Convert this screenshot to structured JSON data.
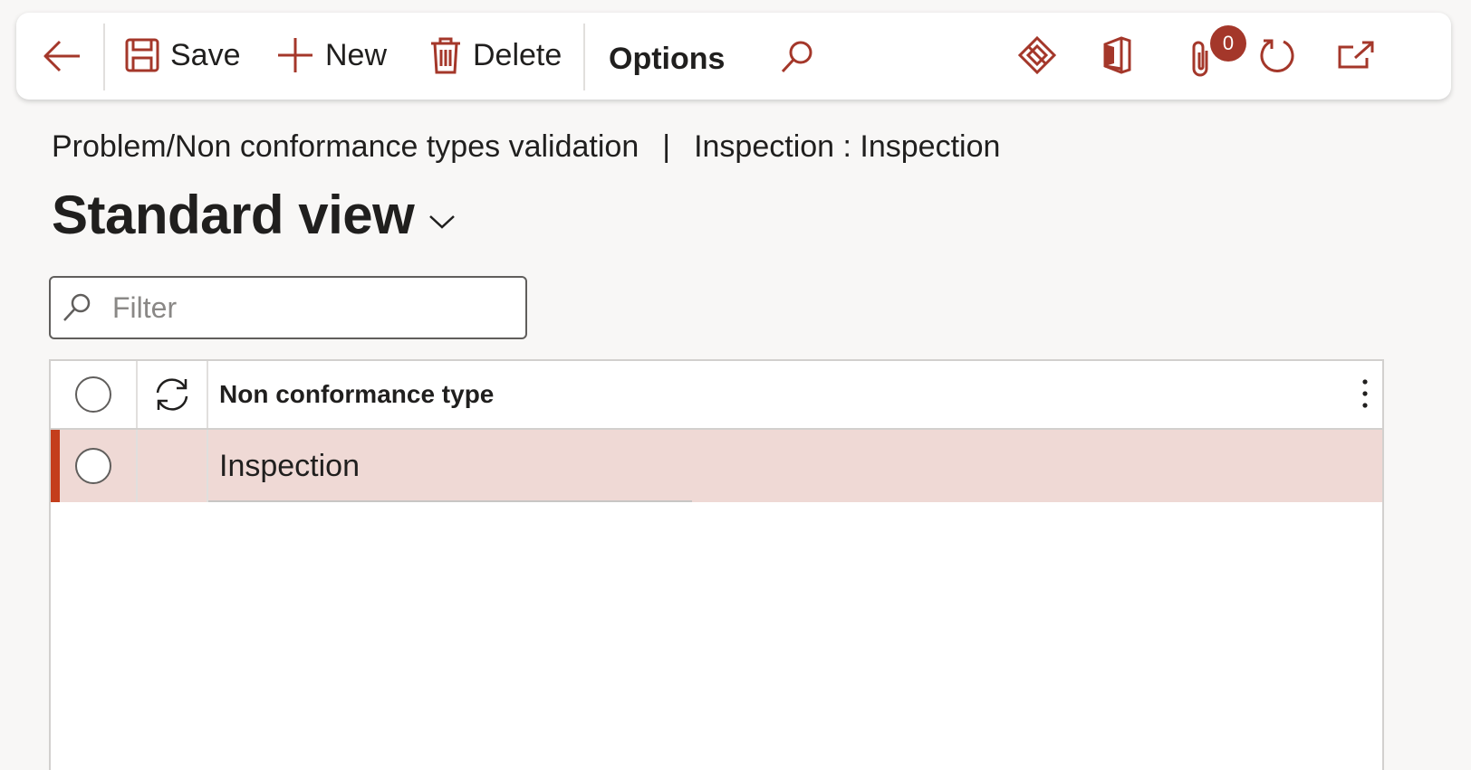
{
  "toolbar": {
    "back_icon": "back-arrow-icon",
    "save_label": "Save",
    "new_label": "New",
    "delete_label": "Delete",
    "options_label": "Options",
    "attachments_count": "0",
    "accent_color": "#a4372a"
  },
  "breadcrumb": {
    "page": "Problem/Non conformance types validation",
    "separator": "|",
    "record": "Inspection : Inspection"
  },
  "view": {
    "title": "Standard view"
  },
  "filter": {
    "placeholder": "Filter",
    "value": ""
  },
  "grid": {
    "columns": [
      "Non conformance type"
    ],
    "rows": [
      {
        "non_conformance_type": "Inspection",
        "selected": true
      }
    ],
    "selected_row_color": "#efd9d5",
    "marker_color": "#c43e1c"
  }
}
